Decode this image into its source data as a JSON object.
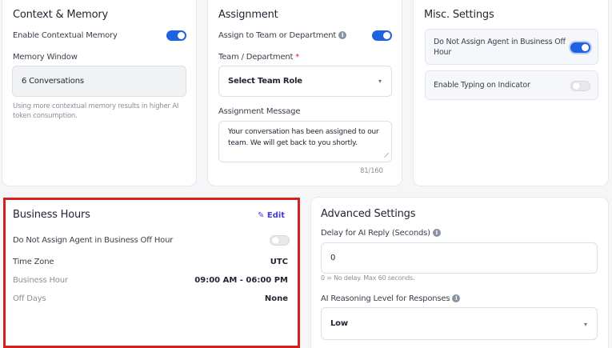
{
  "context": {
    "title": "Context & Memory",
    "enable_label": "Enable Contextual Memory",
    "window_label": "Memory Window",
    "window_value": "6 Conversations",
    "help": "Using more contextual memory results in higher AI token consumption."
  },
  "assignment": {
    "title": "Assignment",
    "assign_label": "Assign to Team or Department",
    "team_label": "Team / Department",
    "required_mark": "*",
    "team_value": "Select Team Role",
    "message_label": "Assignment Message",
    "message_value": "Your conversation has been assigned to our team. We will get back to you shortly.",
    "counter": "81/160"
  },
  "misc": {
    "title": "Misc. Settings",
    "offhour_label": "Do Not Assign Agent in Business Off Hour",
    "typing_label": "Enable Typing on Indicator"
  },
  "business": {
    "title": "Business Hours",
    "edit_label": "Edit",
    "offhour_label": "Do Not Assign Agent in Business Off Hour",
    "timezone_label": "Time Zone",
    "timezone_value": "UTC",
    "hour_label": "Business Hour",
    "hour_value": "09:00 AM - 06:00 PM",
    "offdays_label": "Off Days",
    "offdays_value": "None"
  },
  "advanced": {
    "title": "Advanced Settings",
    "delay_label": "Delay for AI Reply (Seconds)",
    "delay_value": "0",
    "delay_help": "0 = No delay. Max 60 seconds.",
    "reasoning_label": "AI Reasoning Level for Responses",
    "reasoning_value": "Low"
  },
  "colors": {
    "accent": "#1d63e0",
    "highlight": "#d32020",
    "edit": "#4b3bd6"
  }
}
